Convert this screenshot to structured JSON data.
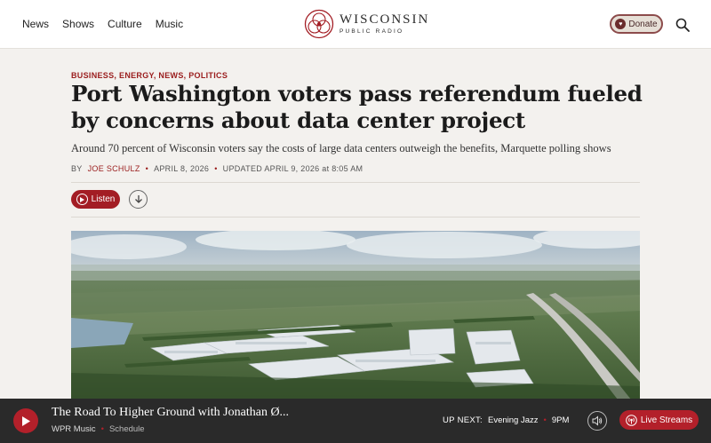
{
  "nav": {
    "items": [
      "News",
      "Shows",
      "Culture",
      "Music"
    ]
  },
  "logo": {
    "name": "WISCONSIN",
    "sub": "PUBLIC RADIO"
  },
  "header": {
    "donate_label": "Donate"
  },
  "article": {
    "categories": "BUSINESS, ENERGY, NEWS, POLITICS",
    "title": "Port Washington voters pass referendum fueled by concerns about data center project",
    "dek": "Around 70 percent of Wisconsin voters say the costs of large data centers outweigh the benefits, Marquette polling shows",
    "by_prefix": "BY",
    "author": "JOE SCHULZ",
    "date": "APRIL 8, 2026",
    "updated": "UPDATED APRIL 9, 2026 at 8:05 AM",
    "listen_label": "Listen"
  },
  "player": {
    "show_title": "The Road To Higher Ground with Jonathan Ø...",
    "station": "WPR Music",
    "schedule": "Schedule",
    "up_next_label": "UP NEXT:",
    "up_next_show": "Evening Jazz",
    "up_next_time": "9PM",
    "live_label": "Live Streams"
  },
  "colors": {
    "accent": "#a31d24",
    "player_bg": "#2a2a2a",
    "page_bg": "#f3f1ee"
  },
  "icons": [
    "logo-icon",
    "heart-icon",
    "search-icon",
    "play-circle-icon",
    "download-icon",
    "play-icon",
    "volume-icon",
    "broadcast-icon"
  ]
}
